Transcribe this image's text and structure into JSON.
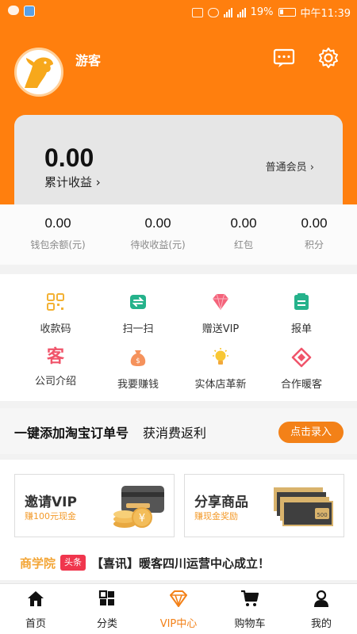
{
  "status_bar": {
    "battery": "19%",
    "time": "中午11:39"
  },
  "header": {
    "username": "游客"
  },
  "earnings": {
    "amount": "0.00",
    "label": "累计收益",
    "member_level": "普通会员"
  },
  "stats": [
    {
      "value": "0.00",
      "label": "钱包余额(元)"
    },
    {
      "value": "0.00",
      "label": "待收收益(元)"
    },
    {
      "value": "0.00",
      "label": "红包"
    },
    {
      "value": "0.00",
      "label": "积分"
    }
  ],
  "grid": [
    {
      "label": "收款码",
      "icon": "qr-code-icon"
    },
    {
      "label": "扫一扫",
      "icon": "scan-icon"
    },
    {
      "label": "赠送VIP",
      "icon": "diamond-icon"
    },
    {
      "label": "报单",
      "icon": "report-icon"
    },
    {
      "label": "公司介绍",
      "icon": "company-icon"
    },
    {
      "label": "我要赚钱",
      "icon": "money-bag-icon"
    },
    {
      "label": "实体店革新",
      "icon": "lightbulb-icon"
    },
    {
      "label": "合作暖客",
      "icon": "partner-icon"
    }
  ],
  "taobao_banner": {
    "title": "一键添加淘宝订单号",
    "subtitle": "获消费返利",
    "button": "点击录入"
  },
  "promos": [
    {
      "title": "邀请VIP",
      "subtitle": "赚100元现金"
    },
    {
      "title": "分享商品",
      "subtitle": "赚现金奖励"
    }
  ],
  "news": {
    "section": "商学院",
    "tag": "头条",
    "text": "【喜讯】暖客四川运营中心成立！"
  },
  "tabs": [
    {
      "label": "首页",
      "icon": "home-icon"
    },
    {
      "label": "分类",
      "icon": "category-icon"
    },
    {
      "label": "VIP中心",
      "icon": "vip-diamond-icon"
    },
    {
      "label": "购物车",
      "icon": "cart-icon"
    },
    {
      "label": "我的",
      "icon": "user-icon"
    }
  ],
  "colors": {
    "brand_orange": "#ff7f0e",
    "accent": "#f38118",
    "gold": "#f3a535",
    "tag_red": "#f0364d"
  }
}
